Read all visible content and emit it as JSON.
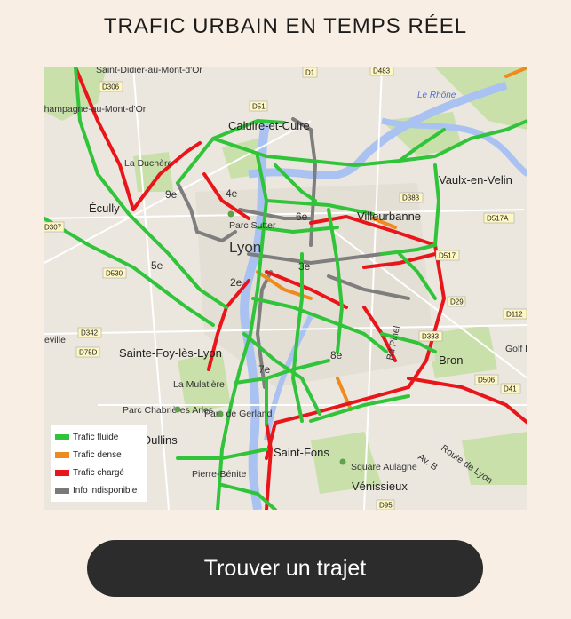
{
  "header": {
    "title": "TRAFIC URBAIN EN TEMPS RÉEL"
  },
  "map": {
    "places": [
      {
        "id": "saint-didier",
        "label": "Saint-Didier-au-Mont-d'Or"
      },
      {
        "id": "champagne",
        "label": "Champagne-au-Mont-d'Or"
      },
      {
        "id": "caluire",
        "label": "Caluire-et-Cuire"
      },
      {
        "id": "la-duchere",
        "label": "La Duchère"
      },
      {
        "id": "ecully",
        "label": "Écully"
      },
      {
        "id": "villeurbanne",
        "label": "Villeurbanne"
      },
      {
        "id": "vaulx",
        "label": "Vaulx-en-Velin"
      },
      {
        "id": "parc-sutter",
        "label": "Parc Sutter"
      },
      {
        "id": "lyon",
        "label": "Lyon"
      },
      {
        "id": "sainte-foy",
        "label": "Sainte-Foy-lès-Lyon"
      },
      {
        "id": "la-mulatiere",
        "label": "La Mulatière"
      },
      {
        "id": "parc-chabrieres",
        "label": "Parc Chabrières Arles"
      },
      {
        "id": "parc-gerland",
        "label": "Parc de Gerland"
      },
      {
        "id": "oullins",
        "label": "Oullins"
      },
      {
        "id": "pierre-benite",
        "label": "Pierre-Bénite"
      },
      {
        "id": "saint-fons",
        "label": "Saint-Fons"
      },
      {
        "id": "square-aulagne",
        "label": "Square Aulagne"
      },
      {
        "id": "venissieux",
        "label": "Vénissieux"
      },
      {
        "id": "bron",
        "label": "Bron"
      },
      {
        "id": "golf-bron",
        "label": "Golf Bron Lyon"
      },
      {
        "id": "eville",
        "label": "eville"
      },
      {
        "id": "le-rhone",
        "label": "Le Rhône"
      },
      {
        "id": "bd-pinel",
        "label": "Bd Pinel"
      },
      {
        "id": "route-lyon",
        "label": "Route de Lyon"
      },
      {
        "id": "av-b",
        "label": "Av. B"
      }
    ],
    "arrondissements": [
      "9e",
      "4e",
      "6e",
      "5e",
      "2e",
      "3e",
      "8e",
      "7e"
    ],
    "roads": [
      "D306",
      "D1",
      "D483",
      "D51",
      "D383",
      "D517A",
      "D307",
      "D517",
      "D530",
      "D29",
      "D112",
      "D342",
      "D75D",
      "D506",
      "D41",
      "D383",
      "D95"
    ],
    "legend": [
      {
        "label": "Trafic fluide",
        "color": "#31c43a"
      },
      {
        "label": "Trafic dense",
        "color": "#ee8a1e"
      },
      {
        "label": "Trafic chargé",
        "color": "#e8161b"
      },
      {
        "label": "Info indisponible",
        "color": "#7a7a7a"
      }
    ],
    "colors": {
      "river": "#a9c2f2",
      "park": "#c7dfa6",
      "urban": "#eae6df"
    }
  },
  "cta": {
    "label": "Trouver un trajet"
  }
}
